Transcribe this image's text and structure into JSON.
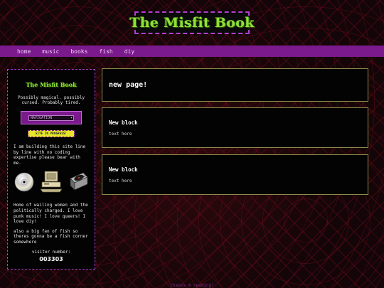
{
  "header": {
    "site_title": "The Misfit Book"
  },
  "nav": {
    "items": [
      {
        "label": "home"
      },
      {
        "label": "music"
      },
      {
        "label": "books"
      },
      {
        "label": "fish"
      },
      {
        "label": "diy"
      }
    ]
  },
  "sidebar": {
    "logo_text": "The Misfit Book",
    "tagline": "Possibly magical. possibly cursed. Probably tired.",
    "navigation_select": {
      "selected": "NAVIGATION"
    },
    "progress_badge": "SITE IN PROGRESS!",
    "intro_text": "I am building this site line by line with no coding expertise please bear with me.",
    "icons": [
      "cd-icon",
      "computer-icon",
      "record-player-icon"
    ],
    "about_text": "Home of wailing women and the politically charged. I love punk music! I love queers! I love diy!",
    "fish_text": "also a big fan of fish so theres gonna be a fish corner somewhere",
    "visitor_label": "visitor number:",
    "visitor_count": "003303"
  },
  "main": {
    "page_title": "new page!",
    "blocks": [
      {
        "title": "New block",
        "text": "text here"
      },
      {
        "title": "New block",
        "text": "text here"
      }
    ]
  },
  "footer": {
    "text": "thanks 4 reading!"
  },
  "colors": {
    "accent_purple": "#7a1a8c",
    "title_green": "#8fe03a",
    "block_border": "#8a8a4a",
    "badge_yellow": "#e6e62a"
  }
}
